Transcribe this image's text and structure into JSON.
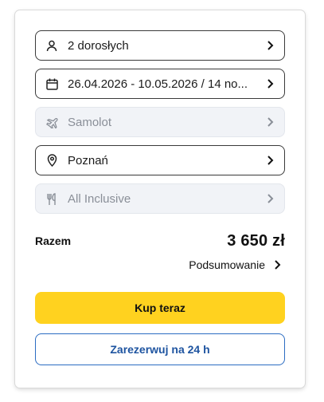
{
  "form": {
    "travelers": {
      "label": "2 dorosłych",
      "icon": "person-icon"
    },
    "dates": {
      "label": "26.04.2026 - 10.05.2026 / 14 no...",
      "icon": "calendar-icon"
    },
    "transport": {
      "label": "Samolot",
      "icon": "plane-icon",
      "disabled": true
    },
    "departure": {
      "label": "Poznań",
      "icon": "location-pin-icon"
    },
    "board": {
      "label": "All Inclusive",
      "icon": "cutlery-icon",
      "disabled": true
    }
  },
  "total": {
    "label": "Razem",
    "value": "3 650 zł"
  },
  "summary": {
    "label": "Podsumowanie"
  },
  "actions": {
    "buy_label": "Kup teraz",
    "reserve_label": "Zarezerwuj na 24 h"
  },
  "colors": {
    "accent_yellow": "#ffd21f",
    "link_blue": "#1e54a0",
    "disabled_bg": "#f1f3f7"
  }
}
